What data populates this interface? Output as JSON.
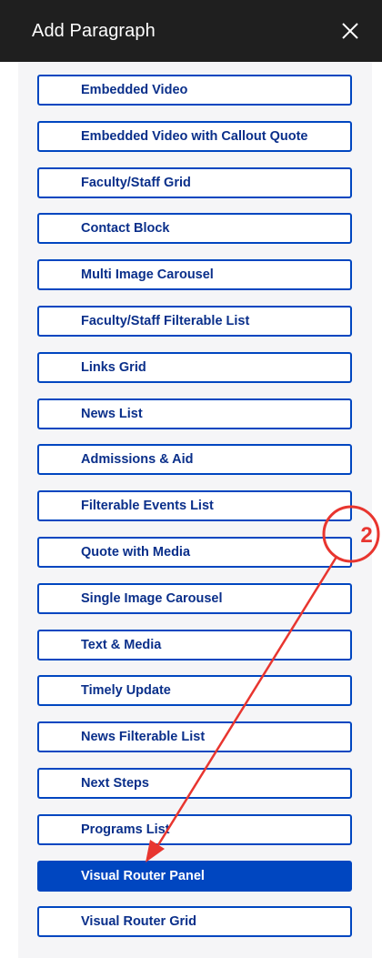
{
  "header": {
    "title": "Add Paragraph",
    "close_icon": "close-icon"
  },
  "paragraph_types": [
    {
      "label": "Embedded Video",
      "active": false
    },
    {
      "label": "Embedded Video with Callout Quote",
      "active": false
    },
    {
      "label": "Faculty/Staff Grid",
      "active": false
    },
    {
      "label": "Contact Block",
      "active": false
    },
    {
      "label": "Multi Image Carousel",
      "active": false
    },
    {
      "label": "Faculty/Staff Filterable List",
      "active": false
    },
    {
      "label": "Links Grid",
      "active": false
    },
    {
      "label": "News List",
      "active": false
    },
    {
      "label": "Admissions & Aid",
      "active": false
    },
    {
      "label": "Filterable Events List",
      "active": false
    },
    {
      "label": "Quote with Media",
      "active": false
    },
    {
      "label": "Single Image Carousel",
      "active": false
    },
    {
      "label": "Text & Media",
      "active": false
    },
    {
      "label": "Timely Update",
      "active": false
    },
    {
      "label": "News Filterable List",
      "active": false
    },
    {
      "label": "Next Steps",
      "active": false
    },
    {
      "label": "Programs List",
      "active": false
    },
    {
      "label": "Visual Router Panel",
      "active": true
    },
    {
      "label": "Visual Router Grid",
      "active": false
    }
  ],
  "annotation": {
    "step_number": "2",
    "color": "#e8352f"
  },
  "colors": {
    "header_bg": "#1f1f1f",
    "accent": "#0046c0",
    "button_text": "#0a2f8a",
    "panel_bg": "#f5f5f7"
  }
}
